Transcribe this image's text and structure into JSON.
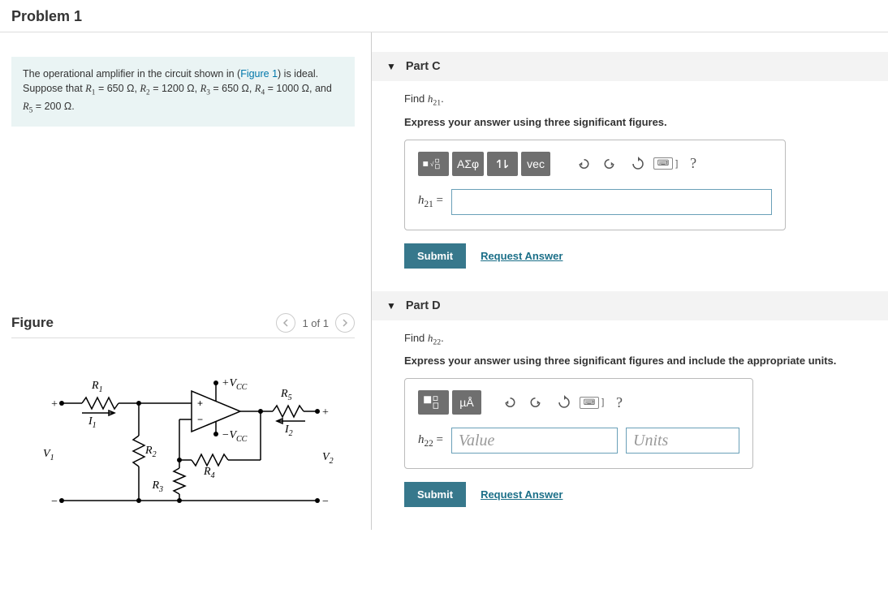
{
  "header": {
    "title": "Problem 1"
  },
  "stem": {
    "pre": "The operational amplifier in the circuit shown in (",
    "figlink": "Figure 1",
    "post1": ") is ideal. Suppose that ",
    "r1": "R",
    "r1s": "1",
    "eq": " = ",
    "r1v": "650 ",
    "ohm": "Ω",
    "r2": "R",
    "r2s": "2",
    "r2v": "1200 ",
    "r3": "R",
    "r3s": "3",
    "r3v": "650 ",
    "r4": "R",
    "r4s": "4",
    "r4v": "1000 ",
    "r5": "R",
    "r5s": "5",
    "r5v": "200 ",
    "sep": ", ",
    "and": ", and ",
    "dot": "."
  },
  "figure": {
    "heading": "Figure",
    "pager": "1 of 1",
    "labels": {
      "R1": "R",
      "R1s": "1",
      "R2": "R",
      "R2s": "2",
      "R3": "R",
      "R3s": "3",
      "R4": "R",
      "R4s": "4",
      "R5": "R",
      "R5s": "5",
      "V1": "V",
      "V1s": "1",
      "V2": "V",
      "V2s": "2",
      "I1": "I",
      "I1s": "1",
      "I2": "I",
      "I2s": "2",
      "Vccp": "+V",
      "Vccps": "CC",
      "Vccm": "−V",
      "Vccms": "CC",
      "plus": "+",
      "minus": "−"
    }
  },
  "parts": {
    "C": {
      "title": "Part C",
      "find_pre": "Find ",
      "var": "h",
      "vars": "21",
      "find_post": ".",
      "instr": "Express your answer using three significant figures.",
      "lhs_var": "h",
      "lhs_sub": "21",
      "lhs_eq": " =",
      "tb": {
        "greek": "ΑΣφ",
        "vec": "vec"
      },
      "submit": "Submit",
      "request": "Request Answer"
    },
    "D": {
      "title": "Part D",
      "find_pre": "Find ",
      "var": "h",
      "vars": "22",
      "find_post": ".",
      "instr": "Express your answer using three significant figures and include the appropriate units.",
      "lhs_var": "h",
      "lhs_sub": "22",
      "lhs_eq": " =",
      "value_ph": "Value",
      "units_ph": "Units",
      "tb": {
        "units": "µÅ"
      },
      "submit": "Submit",
      "request": "Request Answer"
    }
  },
  "icons": {
    "help": "?"
  }
}
